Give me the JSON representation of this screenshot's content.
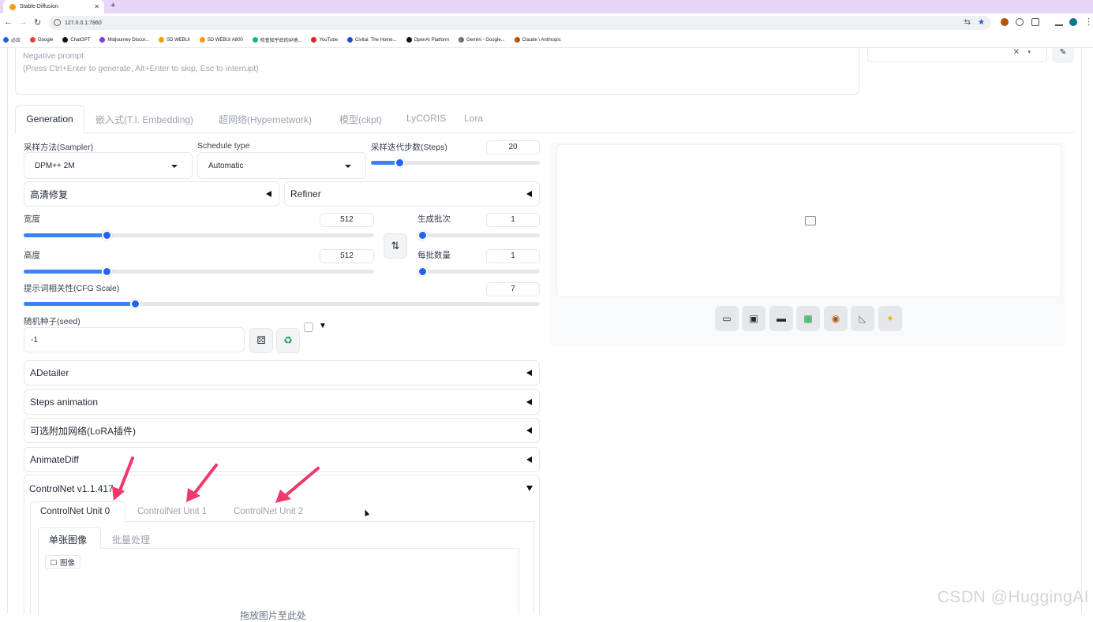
{
  "browser": {
    "tab_title": "Stable Diffusion",
    "tab_close": "✕",
    "new_tab": "+",
    "url": "127.0.0.1:7860",
    "bookmarks": [
      "必应",
      "Google",
      "ChatGPT",
      "Midjourney Discor...",
      "SD WEBUI",
      "SD WEBUI A800",
      "检查知乎后的IP地...",
      "YouTube",
      "Civitai: The Home...",
      "OpenAI Platform",
      "Gemini - Google...",
      "Claude \\ Anthropic"
    ]
  },
  "prompt": {
    "negative_placeholder": "Negative prompt",
    "negative_hint": "(Press Ctrl+Enter to generate, Alt+Enter to skip, Esc to interrupt)",
    "style_clear": "✕",
    "style_caret": "▾"
  },
  "tabs": [
    "Generation",
    "嵌入式(T.I. Embedding)",
    "超网络(Hypernetwork)",
    "模型(ckpt)",
    "LyCORIS",
    "Lora"
  ],
  "sampler": {
    "label": "采样方法(Sampler)",
    "value": "DPM++ 2M"
  },
  "schedule": {
    "label": "Schedule type",
    "value": "Automatic"
  },
  "steps": {
    "label": "采样迭代步数(Steps)",
    "value": "20",
    "fraction": 0.15
  },
  "hires": {
    "label": "高清修复"
  },
  "refiner": {
    "label": "Refiner"
  },
  "width": {
    "label": "宽度",
    "value": "512",
    "fraction": 0.23
  },
  "height": {
    "label": "高度",
    "value": "512",
    "fraction": 0.23
  },
  "batch_count": {
    "label": "生成批次",
    "value": "1",
    "fraction": 0.0
  },
  "batch_size": {
    "label": "每批数量",
    "value": "1",
    "fraction": 0.0
  },
  "cfg": {
    "label": "提示词相关性(CFG Scale)",
    "value": "7",
    "fraction": 0.21
  },
  "seed": {
    "label": "随机种子(seed)",
    "value": "-1",
    "extra_caret": "▼"
  },
  "accordions": [
    "ADetailer",
    "Steps animation",
    "可选附加网络(LoRA插件)",
    "AnimateDiff"
  ],
  "controlnet": {
    "title": "ControlNet v1.1.417",
    "units": [
      "ControlNet Unit 0",
      "ControlNet Unit 1",
      "ControlNet Unit 2"
    ],
    "subtabs": [
      "单张图像",
      "批量处理"
    ],
    "image_label": "图像",
    "drop_hint": "拖放图片至此处"
  },
  "watermark": "CSDN @HuggingAI",
  "icons": {
    "output_tools": [
      "folder-icon",
      "save-icon",
      "zip-icon",
      "image-icon",
      "palette-icon",
      "ruler-icon",
      "sparkle-icon"
    ],
    "swap": "swap-icon",
    "dice": "dice-icon",
    "recycle": "recycle-icon"
  },
  "colors": {
    "accent": "#3b82f6",
    "arrow": "#f0386b"
  }
}
